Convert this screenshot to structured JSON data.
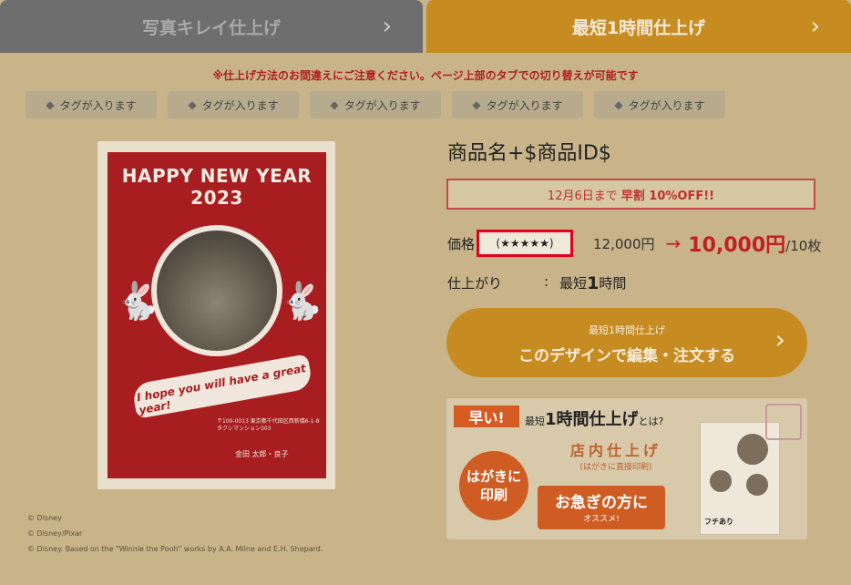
{
  "tabs": {
    "left_label": "写真キレイ仕上げ",
    "right_label": "最短1時間仕上げ",
    "chevron": "›"
  },
  "notice": "※仕上げ方法のお間違えにご注意ください。ページ上部のタブでの切り替えが可能です",
  "tags": [
    "タグが入ります",
    "タグが入ります",
    "タグが入ります",
    "タグが入ります",
    "タグが入ります"
  ],
  "card": {
    "title": "HAPPY NEW YEAR 2023",
    "banner": "I hope you will have a great year!",
    "address": "〒100-0013 東京都千代田区西新橋6-1-8 タクシマンション303",
    "names": "金田 太郎・良子"
  },
  "credits": [
    "© Disney",
    "© Disney/Pixar",
    "© Disney. Based on the \"Winnie the Pooh\" works by A.A. Milne and E.H. Shepard."
  ],
  "product": {
    "title": "商品名+$商品ID$",
    "promo_prefix": "12月6日まで",
    "promo_bold": "早割 10%OFF!!",
    "price_label": "価格",
    "stars": "(★★★★★)",
    "old_price": "12,000円",
    "arrow": "→",
    "new_price": "10,000円",
    "unit": "/10枚",
    "finish_label": "仕上がり",
    "finish_colon": ":",
    "finish_prefix": "最短",
    "finish_num": "1",
    "finish_suffix": "時間"
  },
  "cta": {
    "small": "最短1時間仕上げ",
    "main": "このデザインで編集・注文する",
    "chevron": "›"
  },
  "ad": {
    "badge": "早い!",
    "title_prefix": "最短",
    "title_main": "1時間仕上げ",
    "title_suffix": "とは?",
    "circle": "はがきに 印刷",
    "store": "店内仕上げ",
    "store_sub": "(はがきに直接印刷)",
    "rush_main": "お急ぎの方に",
    "rush_sub": "オススメ!",
    "card_label": "フチあり"
  },
  "colors": {
    "tab_active": "#c68c22",
    "tab_inactive": "#6e6e6e",
    "notice": "#b01f1f",
    "price_red": "#c02020",
    "card_red": "#a71d20",
    "highlight": "#e2001a"
  }
}
